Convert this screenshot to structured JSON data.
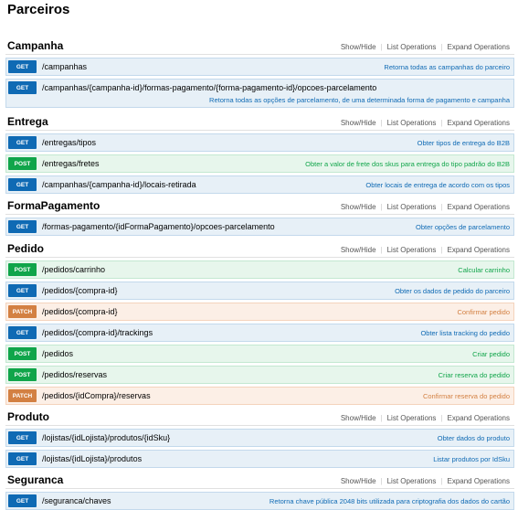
{
  "page": {
    "title": "Parceiros"
  },
  "ops": {
    "show_hide": "Show/Hide",
    "list_ops": "List Operations",
    "expand_ops": "Expand Operations"
  },
  "sections": [
    {
      "name": "Campanha",
      "endpoints": [
        {
          "method": "GET",
          "path": "/campanhas",
          "desc": "Retorna todas as campanhas do parceiro"
        },
        {
          "method": "GET",
          "path": "/campanhas/{campanha-id}/formas-pagamento/{forma-pagamento-id}/opcoes-parcelamento",
          "desc": "Retorna todas as opções de parcelamento, de uma determinada forma de pagamento e campanha"
        }
      ]
    },
    {
      "name": "Entrega",
      "endpoints": [
        {
          "method": "GET",
          "path": "/entregas/tipos",
          "desc": "Obter tipos de entrega do B2B"
        },
        {
          "method": "POST",
          "path": "/entregas/fretes",
          "desc": "Obter a valor de frete dos skus para entrega do tipo padrão do B2B"
        },
        {
          "method": "GET",
          "path": "/campanhas/{campanha-id}/locais-retirada",
          "desc": "Obter locais de entrega de acordo com os tipos"
        }
      ]
    },
    {
      "name": "FormaPagamento",
      "endpoints": [
        {
          "method": "GET",
          "path": "/formas-pagamento/{idFormaPagamento}/opcoes-parcelamento",
          "desc": "Obter opções de parcelamento"
        }
      ]
    },
    {
      "name": "Pedido",
      "endpoints": [
        {
          "method": "POST",
          "path": "/pedidos/carrinho",
          "desc": "Calcular carrinho"
        },
        {
          "method": "GET",
          "path": "/pedidos/{compra-id}",
          "desc": "Obter os dados de pedido do parceiro"
        },
        {
          "method": "PATCH",
          "path": "/pedidos/{compra-id}",
          "desc": "Confirmar pedido"
        },
        {
          "method": "GET",
          "path": "/pedidos/{compra-id}/trackings",
          "desc": "Obter lista tracking do pedido"
        },
        {
          "method": "POST",
          "path": "/pedidos",
          "desc": "Criar pedido"
        },
        {
          "method": "POST",
          "path": "/pedidos/reservas",
          "desc": "Criar reserva do pedido"
        },
        {
          "method": "PATCH",
          "path": "/pedidos/{idCompra}/reservas",
          "desc": "Confirmar reserva do pedido"
        }
      ]
    },
    {
      "name": "Produto",
      "endpoints": [
        {
          "method": "GET",
          "path": "/lojistas/{idLojista}/produtos/{idSku}",
          "desc": "Obter dados do produto"
        },
        {
          "method": "GET",
          "path": "/lojistas/{idLojista}/produtos",
          "desc": "Listar produtos por IdSku"
        }
      ]
    },
    {
      "name": "Seguranca",
      "endpoints": [
        {
          "method": "GET",
          "path": "/seguranca/chaves",
          "desc": "Retorna chave pública 2048 bits utilizada para criptografia dos dados do cartão"
        }
      ]
    }
  ]
}
